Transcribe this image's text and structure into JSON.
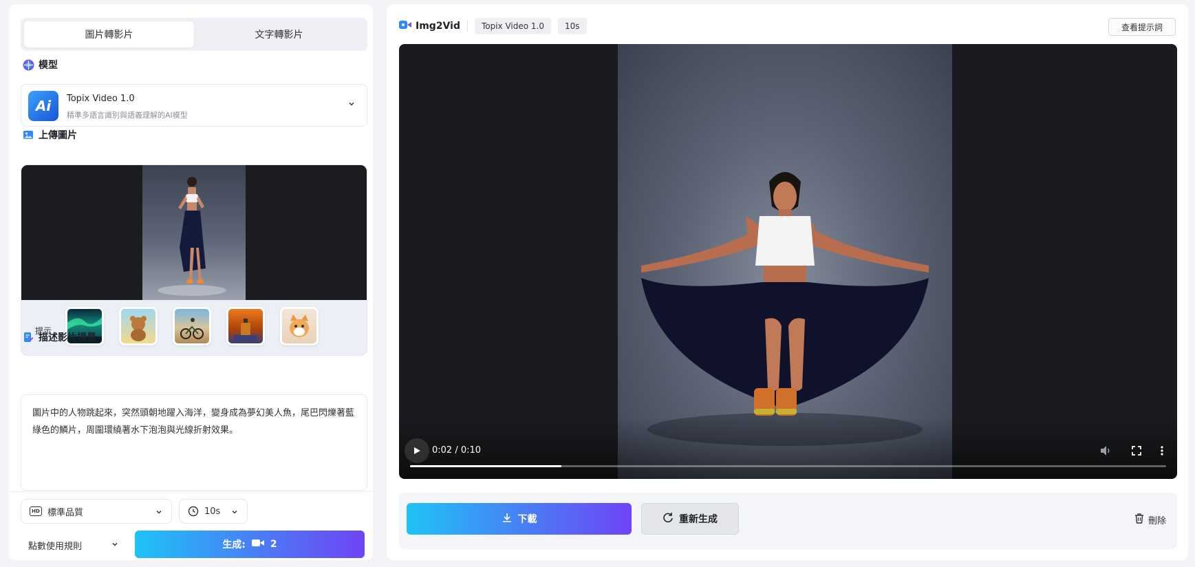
{
  "tabs": [
    {
      "label": "圖片轉影片",
      "active": true
    },
    {
      "label": "文字轉影片",
      "active": false
    }
  ],
  "model_section": {
    "title": "模型",
    "logo_text": "Ai",
    "model_name": "Topix Video 1.0",
    "model_desc": "精準多語言識別與語義理解的AI模型"
  },
  "upload_section": {
    "title": "上傳圖片",
    "hint_label": "提示",
    "hints": [
      "aurora",
      "teddy-bear",
      "cyclist",
      "perfume",
      "kitten"
    ]
  },
  "description_section": {
    "title": "描述影片場景",
    "text": "圖片中的人物跳起來，突然頭朝地躍入海洋，變身成為夢幻美人魚，尾巴閃爍著藍綠色的鱗片，周圍環繞著水下泡泡與光線折射效果。"
  },
  "bottom": {
    "quality": "標準品質",
    "quality_badge": "HD",
    "duration": "10s",
    "rules": "點數使用規則",
    "generate_label": "生成:",
    "generate_cost": "2"
  },
  "right": {
    "brand": "Img2Vid",
    "model_chip": "Topix Video 1.0",
    "duration_chip": "10s",
    "prompt_button": "查看提示詞",
    "video": {
      "current_time": "0:02",
      "duration": "0:10",
      "time_text": "0:02 / 0:10",
      "progress": 0.2
    },
    "download_label": "下載",
    "regenerate_label": "重新生成",
    "delete_label": "刪除"
  },
  "colors": {
    "accent_gradient_start": "#1fc3f6",
    "accent_gradient_end": "#6f44f5",
    "panel_bg": "#ffffff",
    "page_bg": "#f3f4f8"
  }
}
